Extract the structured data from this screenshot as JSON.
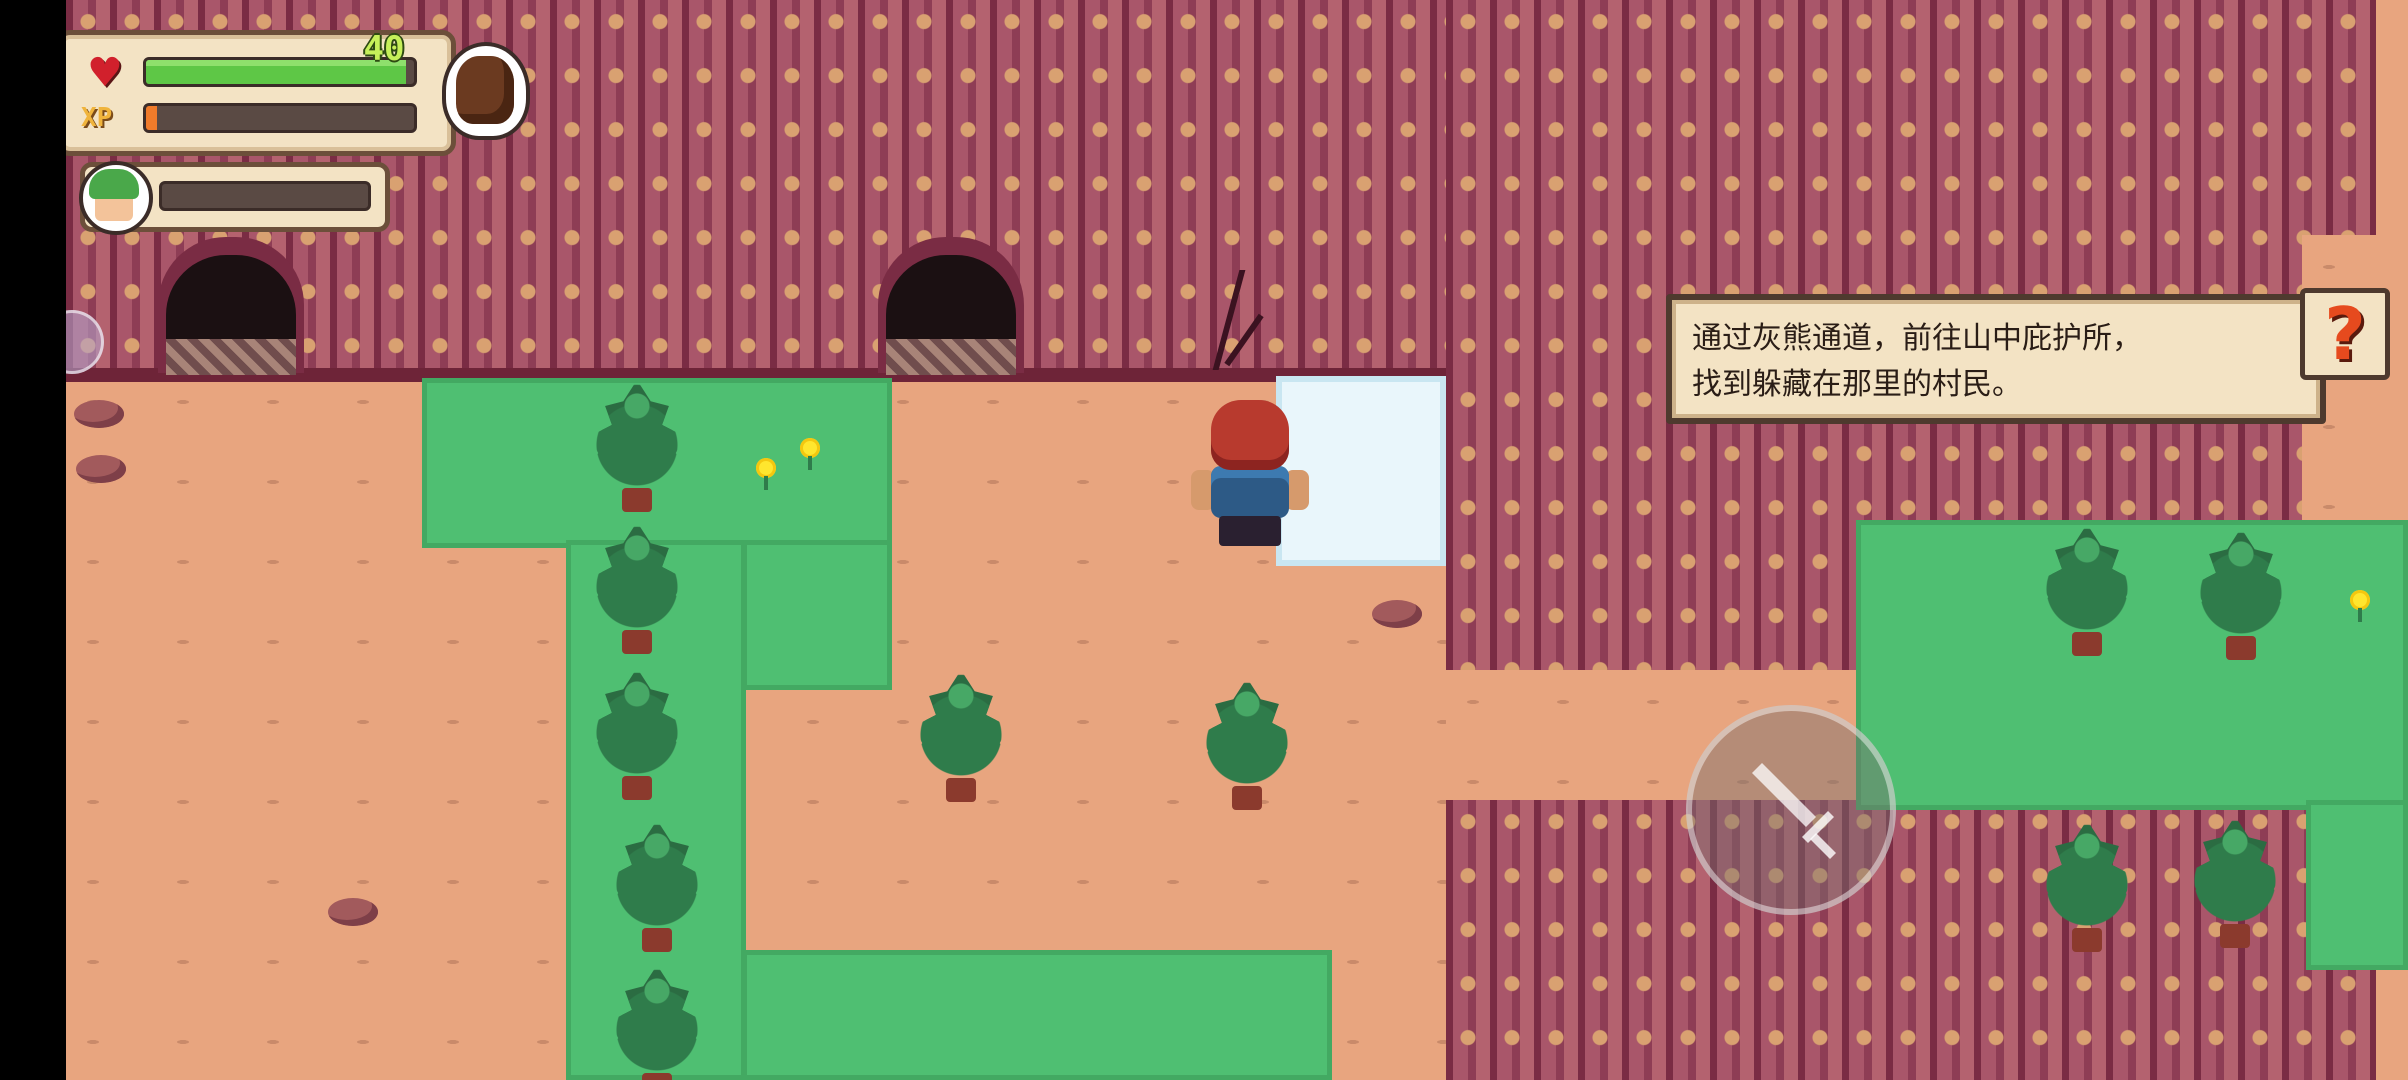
{
  "hud": {
    "level": "40",
    "xp_label": "XP",
    "hp_fraction": 0.97,
    "xp_fraction": 0.04,
    "ally_hp_fraction": 0.0
  },
  "quest": {
    "line1": "通过灰熊通道，前往山中庇护所，",
    "line2": "找到躲藏在那里的村民。"
  },
  "help": {
    "label": "?"
  },
  "icons": {
    "heart": "heart-icon",
    "xp": "xp-icon",
    "companion": "bear-portrait-icon",
    "ally": "green-hair-ally-portrait",
    "attack": "sword-icon"
  },
  "colors": {
    "hp": "#5ec746",
    "xp": "#f07b2a",
    "quest_bg": "#f3e3c4",
    "help_mark": "#e64a1e"
  }
}
